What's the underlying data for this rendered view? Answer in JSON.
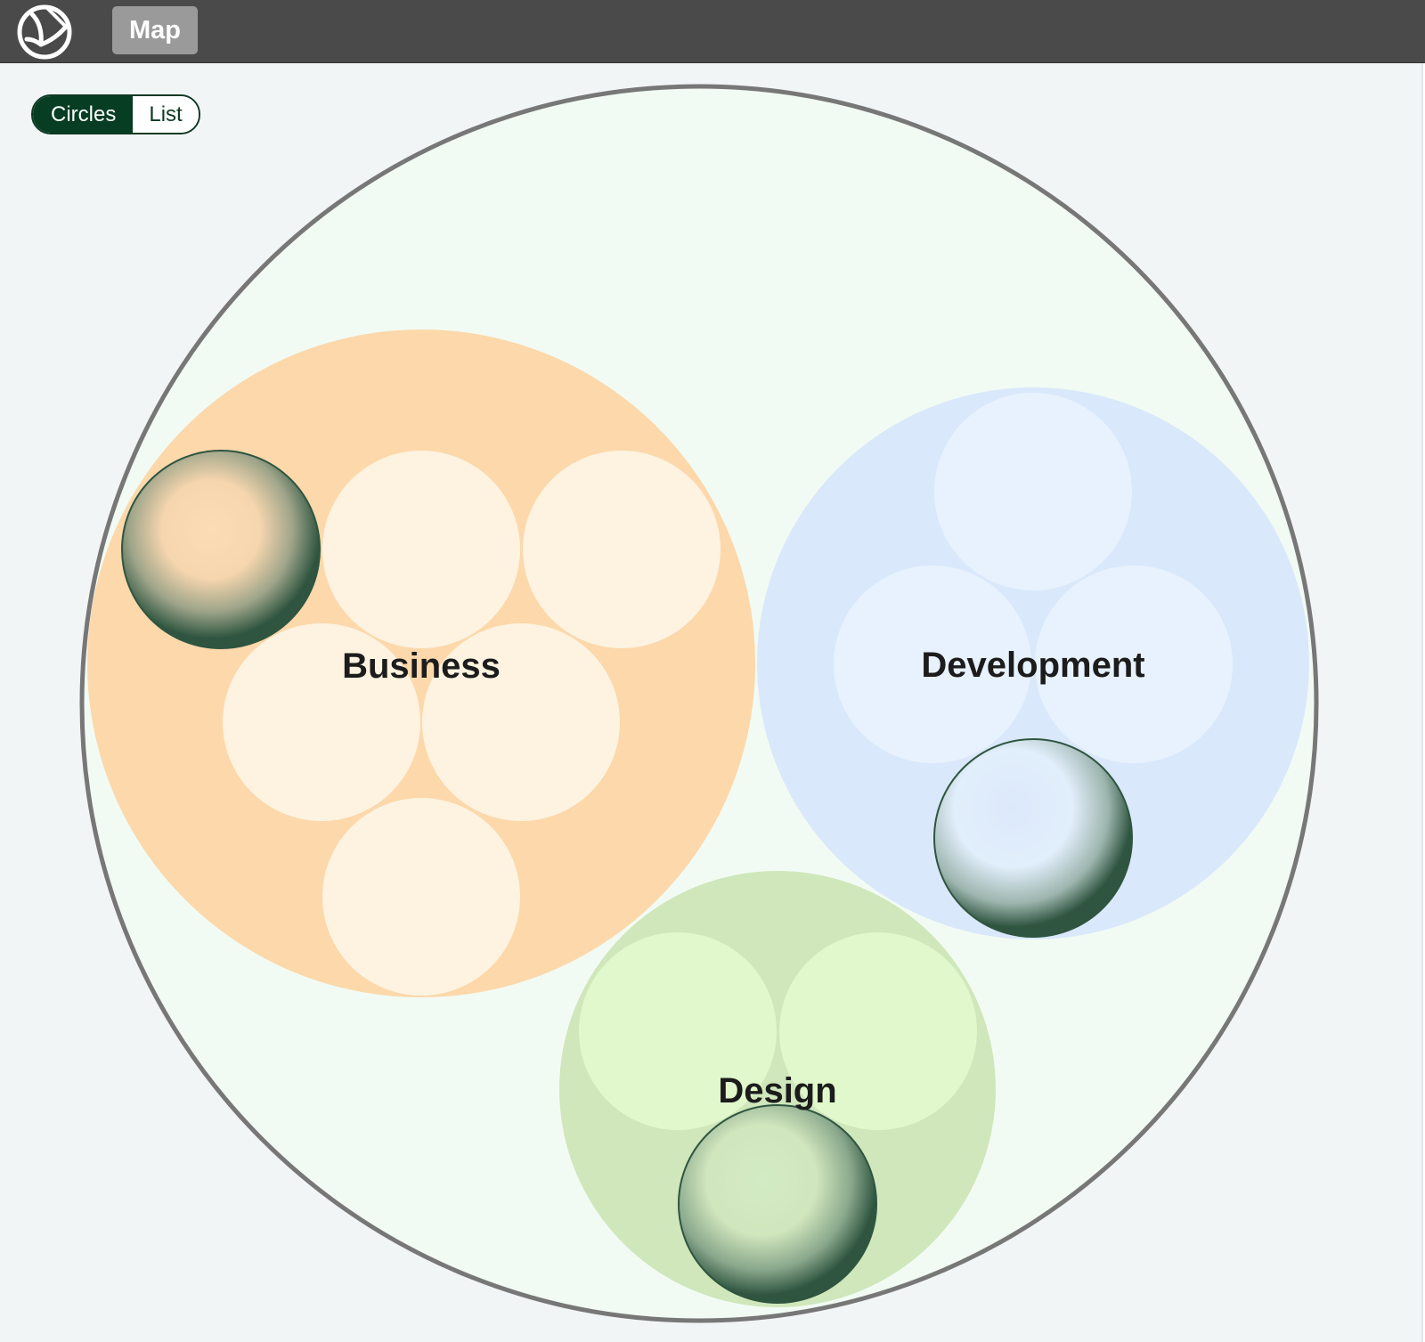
{
  "topbar": {
    "logo_icon": "app-logo-icon",
    "map_button_label": "Map"
  },
  "view_toggle": {
    "options": [
      "Circles",
      "List"
    ],
    "selected": "Circles"
  },
  "circle_map": {
    "groups": [
      {
        "name": "Business",
        "color": "#fcd8ab",
        "child_color": "#fdf3e0",
        "child_count": 6,
        "highlighted_child_count": 1
      },
      {
        "name": "Development",
        "color": "#dae8fb",
        "child_color": "#e7f2fe",
        "child_count": 4,
        "highlighted_child_count": 1
      },
      {
        "name": "Design",
        "color": "#cfe7bb",
        "child_color": "#e0f8cb",
        "child_count": 3,
        "highlighted_child_count": 1
      }
    ],
    "outer_fill": "#f2fbf3",
    "outer_stroke": "#777777",
    "highlight_edge_color": "#2f5540"
  }
}
